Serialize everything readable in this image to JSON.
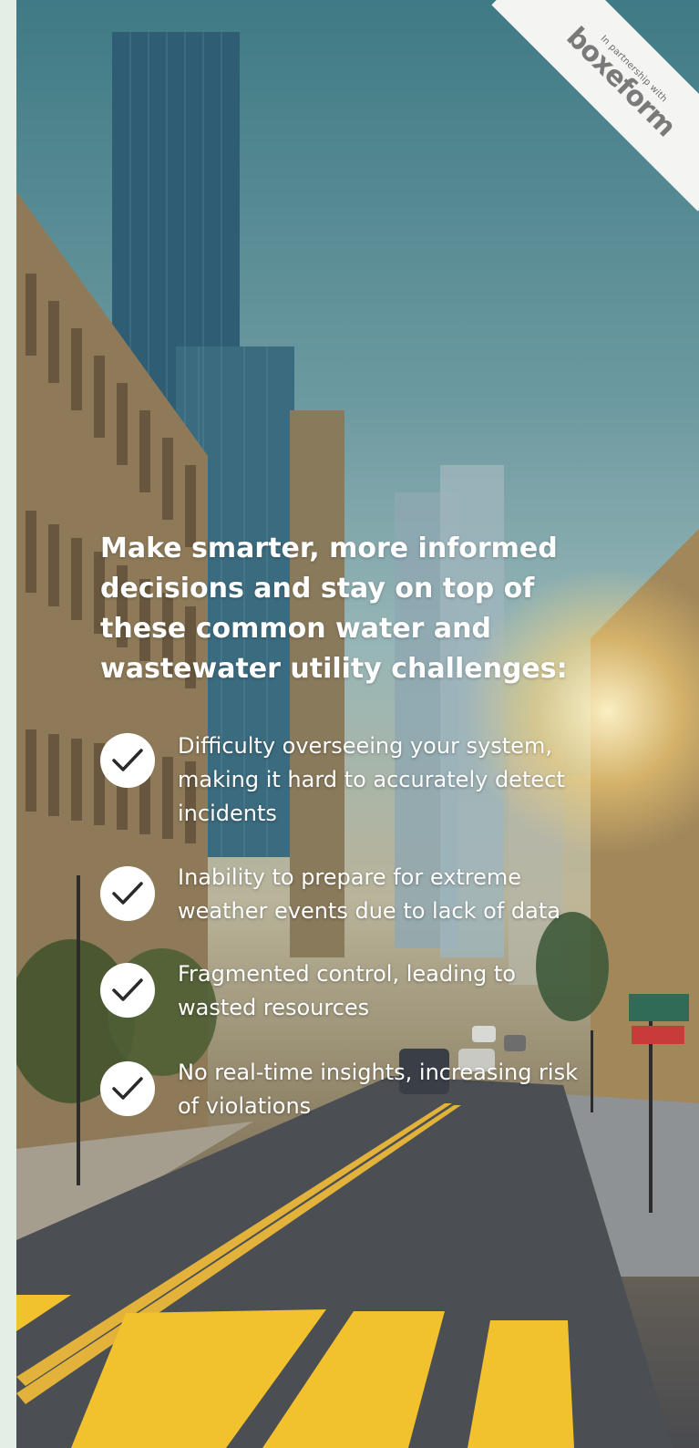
{
  "partner": {
    "label": "In partnership with",
    "logo_text": "boxeform"
  },
  "headline": "Make smarter, more informed decisions and stay on top of these common water and wastewater utility challenges:",
  "challenges": [
    {
      "text": "Difficulty overseeing your system, making it hard to accurately detect incidents",
      "icon": "check-icon"
    },
    {
      "text": "Inability to prepare for extreme weather events due to lack of data",
      "icon": "check-icon"
    },
    {
      "text": "Fragmented control, leading to wasted resources",
      "icon": "check-icon"
    },
    {
      "text": "No real-time insights, increasing risk of violations",
      "icon": "check-icon"
    }
  ],
  "colors": {
    "background_stripe": "#e3efe6",
    "text": "#ffffff",
    "crosswalk": "#f2c12e"
  }
}
